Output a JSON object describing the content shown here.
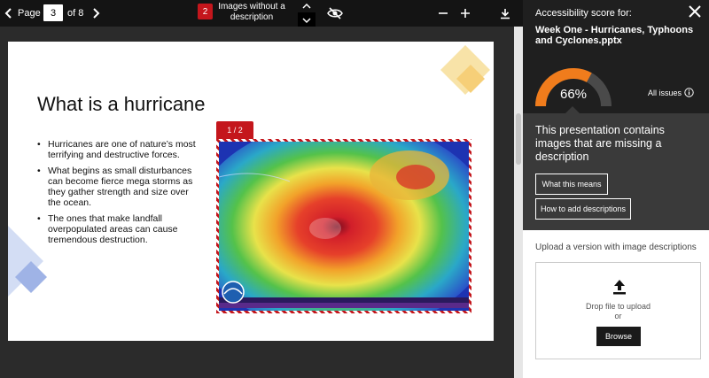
{
  "toolbar": {
    "page_label": "Page",
    "page_current": "3",
    "page_of": "of 8",
    "images_count": "2",
    "images_label": "Images without a description",
    "icons": [
      "chevron-left-icon",
      "chevron-right-icon",
      "chevron-up-icon",
      "chevron-down-icon",
      "eye-off-icon",
      "minus-icon",
      "plus-icon",
      "download-icon"
    ]
  },
  "slide": {
    "title": "What is a hurricane",
    "bullets": [
      "Hurricanes are one of nature’s most terrifying and destructive forces.",
      "What begins as small disturbances can become fierce mega storms as they gather strength and size over the ocean.",
      "The ones that make landfall overpopulated areas can cause tremendous destruction."
    ],
    "image_tab": "1 / 2"
  },
  "panel": {
    "score_for": "Accessibility score for:",
    "file_name": "Week One - Hurricanes, Typhoons and Cyclones.pptx",
    "score_percent": 66,
    "score_label": "66%",
    "all_issues": "All issues",
    "missing_text": "This presentation contains images that are missing a description",
    "what_means": "What this means",
    "how_add": "How to add descriptions",
    "upload_label": "Upload a version with image descriptions",
    "drop_text": "Drop file to upload",
    "or_text": "or",
    "browse": "Browse"
  },
  "colors": {
    "toolbar_bg": "#141414",
    "viewer_bg": "#2b2b2b",
    "panel_dark": "#1f1f1f",
    "panel_mid": "#3a3a3a",
    "badge_red": "#c4161c",
    "gauge_orange": "#f07c1c",
    "gauge_track": "#4a4a4a"
  }
}
